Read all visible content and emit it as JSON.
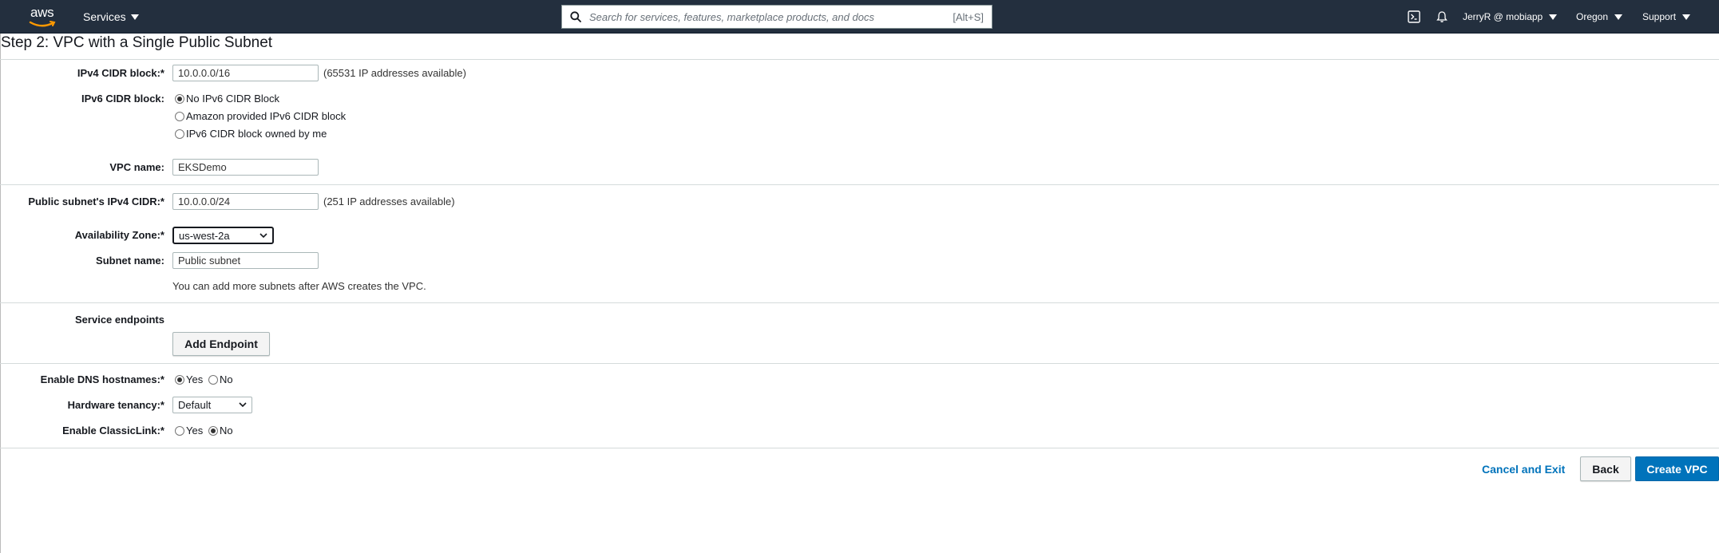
{
  "topnav": {
    "logo_text": "aws",
    "services_label": "Services",
    "search_placeholder": "Search for services, features, marketplace products, and docs",
    "search_shortcut": "[Alt+S]",
    "cloudshell_icon": "cloudshell-icon",
    "notifications_icon": "bell-icon",
    "account_label": "JerryR @ mobiapp",
    "region_label": "Oregon",
    "support_label": "Support"
  },
  "page": {
    "title": "Step 2: VPC with a Single Public Subnet"
  },
  "form": {
    "ipv4_cidr": {
      "label": "IPv4 CIDR block:*",
      "value": "10.0.0.0/16",
      "note": "(65531 IP addresses available)"
    },
    "ipv6_cidr": {
      "label": "IPv6 CIDR block:",
      "options": [
        {
          "label": "No IPv6 CIDR Block",
          "selected": true
        },
        {
          "label": "Amazon provided IPv6 CIDR block",
          "selected": false
        },
        {
          "label": "IPv6 CIDR block owned by me",
          "selected": false
        }
      ]
    },
    "vpc_name": {
      "label": "VPC name:",
      "value": "EKSDemo"
    },
    "public_subnet_cidr": {
      "label": "Public subnet's IPv4 CIDR:*",
      "value": "10.0.0.0/24",
      "note": "(251 IP addresses available)"
    },
    "availability_zone": {
      "label": "Availability Zone:*",
      "value": "us-west-2a"
    },
    "subnet_name": {
      "label": "Subnet name:",
      "value": "Public subnet"
    },
    "subnet_hint": "You can add more subnets after AWS creates the VPC.",
    "service_endpoints": {
      "label": "Service endpoints",
      "button": "Add Endpoint"
    },
    "dns_hostnames": {
      "label": "Enable DNS hostnames:*",
      "yes": "Yes",
      "no": "No",
      "selected": "Yes"
    },
    "hardware_tenancy": {
      "label": "Hardware tenancy:*",
      "value": "Default"
    },
    "classiclink": {
      "label": "Enable ClassicLink:*",
      "yes": "Yes",
      "no": "No",
      "selected": "No"
    }
  },
  "actions": {
    "cancel": "Cancel and Exit",
    "back": "Back",
    "create": "Create VPC"
  },
  "colors": {
    "nav_bg": "#232f3e",
    "primary": "#0073bb",
    "link": "#0073bb"
  }
}
